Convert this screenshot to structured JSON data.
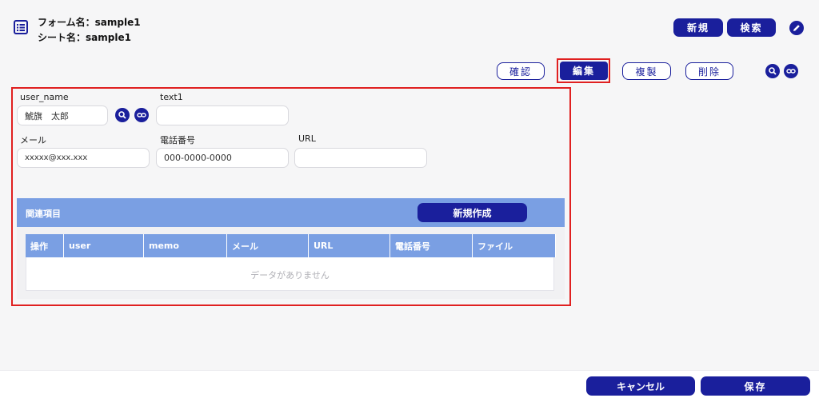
{
  "header": {
    "form_name": "フォーム名：sample1",
    "sheet_name": "シート名：sample1",
    "icon": "list-icon"
  },
  "toolbar_top": {
    "new_label": "新規",
    "search_label": "検索",
    "edit_icon": "pencil-icon"
  },
  "toolbar_actions": {
    "confirm_label": "確認",
    "edit_label": "編集",
    "duplicate_label": "複製",
    "delete_label": "削除",
    "search_icon": "search-icon",
    "link_icon": "link-icon"
  },
  "fields": {
    "user_name": {
      "label": "user_name",
      "value": "鯱旗　太郎"
    },
    "text1": {
      "label": "text1",
      "value": ""
    },
    "mail": {
      "label": "メール",
      "value": "xxxxx@xxx.xxx"
    },
    "phone": {
      "label": "電話番号",
      "value": "000-0000-0000"
    },
    "url": {
      "label": "URL",
      "value": ""
    }
  },
  "related": {
    "title": "関連項目",
    "new_create_label": "新規作成",
    "columns": [
      "操作",
      "user",
      "memo",
      "メール",
      "URL",
      "電話番号",
      "ファイル"
    ],
    "empty_message": "データがありません"
  },
  "footer": {
    "cancel_label": "キャンセル",
    "save_label": "保存"
  },
  "colors": {
    "primary": "#1a1f9c",
    "table_header": "#7a9fe3",
    "highlight": "#e02020"
  }
}
